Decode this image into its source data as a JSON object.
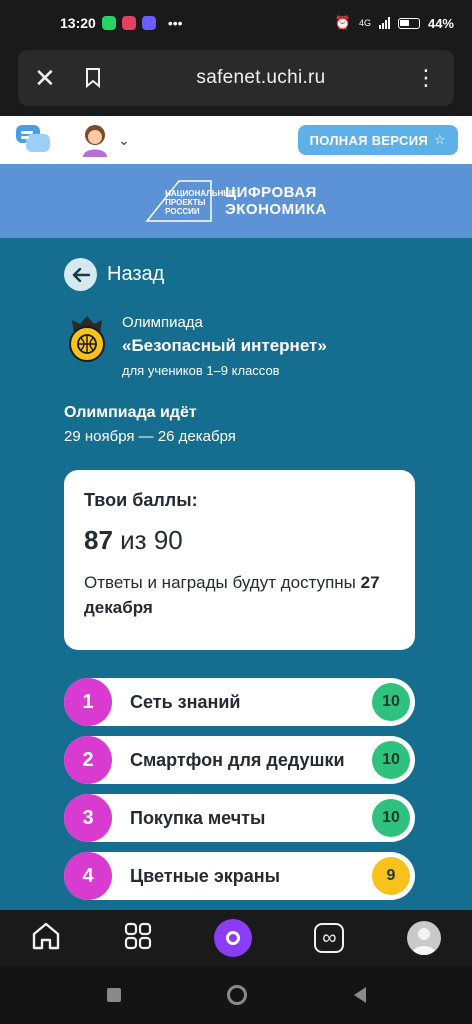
{
  "status_bar": {
    "time": "13:20",
    "battery": "44%",
    "network": "4G"
  },
  "browser": {
    "url": "safenet.uchi.ru"
  },
  "header": {
    "full_version": "ПОЛНАЯ ВЕРСИЯ"
  },
  "banner": {
    "sub": "НАЦИОНАЛЬНЫЕ ПРОЕКТЫ РОССИИ",
    "title_line1": "ЦИФРОВАЯ",
    "title_line2": "ЭКОНОМИКА"
  },
  "main": {
    "back_label": "Назад",
    "olympiad": {
      "line1": "Олимпиада",
      "line2": "«Безопасный интернет»",
      "line3": "для учеников 1–9 классов"
    },
    "status": {
      "title": "Олимпиада идёт",
      "dates": "29 ноября — 26 декабря"
    },
    "score_card": {
      "title": "Твои баллы:",
      "score": "87",
      "of": " из 90",
      "note_prefix": "Ответы и награды будут доступны ",
      "note_date": "27 декабря"
    },
    "tasks": [
      {
        "num": "1",
        "name": "Сеть знаний",
        "score": "10",
        "color": "#2ec27e"
      },
      {
        "num": "2",
        "name": "Смартфон для дедушки",
        "score": "10",
        "color": "#2ec27e"
      },
      {
        "num": "3",
        "name": "Покупка мечты",
        "score": "10",
        "color": "#2ec27e"
      },
      {
        "num": "4",
        "name": "Цветные экраны",
        "score": "9",
        "color": "#f7c21c"
      }
    ]
  },
  "colors": {
    "accent_blue": "#5db1e8",
    "main_bg": "#156e8f",
    "task_num": "#d93bd0",
    "alice_purple": "#8b3cf6"
  }
}
